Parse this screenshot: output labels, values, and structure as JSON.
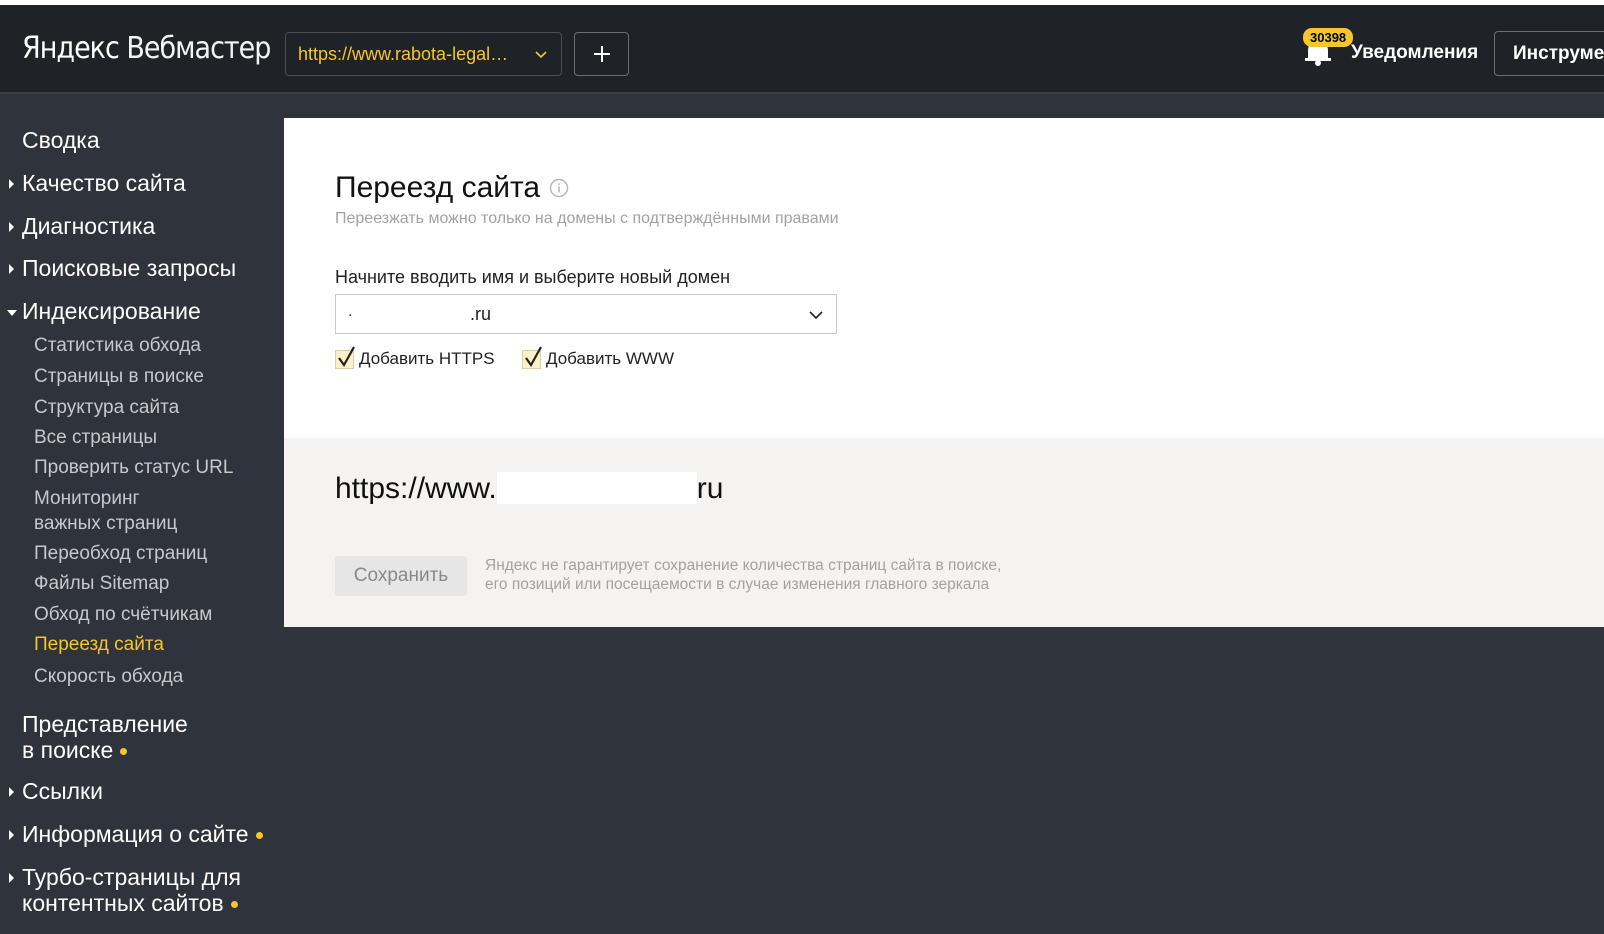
{
  "header": {
    "logo_part1": "Яндекс",
    "logo_part2": "Вебмастер",
    "site_url": "https://www.rabota-legal…",
    "add_label": "+",
    "notifications_count": "30398",
    "notifications_label": "Уведомления",
    "tools_label": "Инструмен",
    "accent_color": "#f6c62e"
  },
  "sidebar": {
    "items": [
      {
        "label": "Сводка"
      },
      {
        "label": "Качество сайта"
      },
      {
        "label": "Диагностика"
      },
      {
        "label": "Поисковые запросы"
      },
      {
        "label": "Индексирование"
      },
      {
        "label": "Представление"
      },
      {
        "label": "в поиске"
      },
      {
        "label": "Ссылки"
      },
      {
        "label": "Информация о сайте"
      },
      {
        "label": "Турбо-страницы для"
      },
      {
        "label": "контентных сайтов"
      }
    ],
    "sub_items": [
      {
        "label": "Статистика обхода"
      },
      {
        "label": "Страницы в поиске"
      },
      {
        "label": "Структура сайта"
      },
      {
        "label": "Все страницы"
      },
      {
        "label": "Проверить статус URL"
      },
      {
        "label": "Мониторинг"
      },
      {
        "label": "важных страниц"
      },
      {
        "label": "Переобход страниц"
      },
      {
        "label": "Файлы Sitemap"
      },
      {
        "label": "Обход по счётчикам"
      },
      {
        "label": "Переезд сайта",
        "active": true
      },
      {
        "label": "Скорость обхода"
      }
    ]
  },
  "main": {
    "title": "Переезд сайта",
    "subtitle": "Переезжать можно только на домены с подтверждёнными правами",
    "field_label": "Начните вводить имя и выберите новый домен",
    "domain_prefix": ".",
    "domain_value": ".ru",
    "checkbox_https": {
      "label": "Добавить HTTPS",
      "checked": true
    },
    "checkbox_www": {
      "label": "Добавить WWW",
      "checked": true
    },
    "result_url_prefix": "https://www.",
    "result_url_suffix": "ru",
    "save_label": "Сохранить",
    "disclaimer_line1": "Яндекс не гарантирует сохранение количества страниц сайта в поиске,",
    "disclaimer_line2": "его позиций или посещаемости в случае изменения главного зеркала"
  }
}
